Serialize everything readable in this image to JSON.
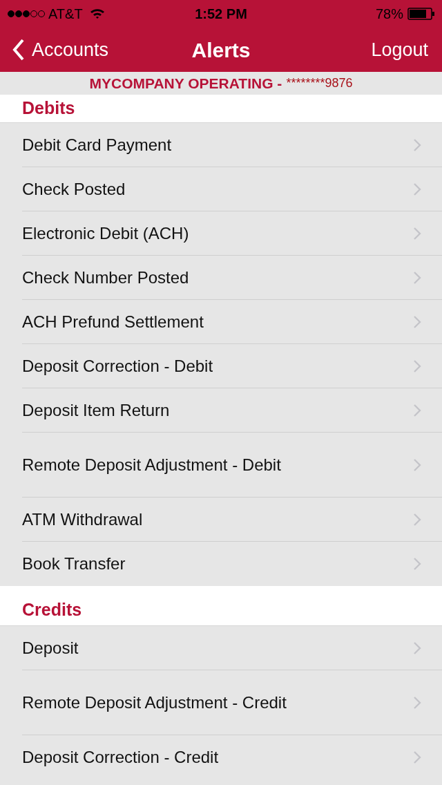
{
  "status_bar": {
    "carrier": "AT&T",
    "time": "1:52 PM",
    "battery": "78%"
  },
  "nav": {
    "back": "Accounts",
    "title": "Alerts",
    "action": "Logout"
  },
  "account": {
    "name": "MYCOMPANY OPERATING -",
    "number": "********9876"
  },
  "sections": [
    {
      "title": "Debits",
      "kind": "first",
      "items": [
        {
          "label": "Debit Card Payment",
          "kind": "standard"
        },
        {
          "label": "Check Posted",
          "kind": "standard"
        },
        {
          "label": "Electronic Debit (ACH)",
          "kind": "standard"
        },
        {
          "label": "Check Number Posted",
          "kind": "standard"
        },
        {
          "label": "ACH Prefund Settlement",
          "kind": "standard"
        },
        {
          "label": "Deposit Correction - Debit",
          "kind": "standard"
        },
        {
          "label": "Deposit Item Return",
          "kind": "standard"
        },
        {
          "label": "Remote Deposit Adjustment - Debit",
          "kind": "tall"
        },
        {
          "label": "ATM Withdrawal",
          "kind": "standard"
        },
        {
          "label": "Book Transfer",
          "kind": "standard"
        }
      ]
    },
    {
      "title": "Credits",
      "kind": "spaced",
      "items": [
        {
          "label": "Deposit",
          "kind": "standard"
        },
        {
          "label": "Remote Deposit Adjustment - Credit",
          "kind": "tall"
        },
        {
          "label": "Deposit Correction - Credit",
          "kind": "standard"
        }
      ]
    }
  ]
}
